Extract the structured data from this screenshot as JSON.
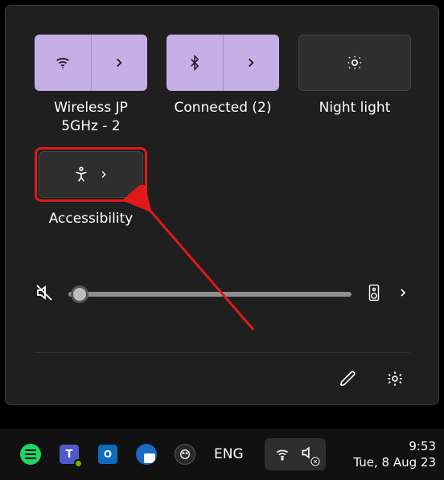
{
  "tiles": {
    "wifi": {
      "label": "Wireless JP 5GHz - 2",
      "on": true
    },
    "bluetooth": {
      "label": "Connected (2)",
      "on": true
    },
    "nightlight": {
      "label": "Night light",
      "on": false
    },
    "accessibility": {
      "label": "Accessibility",
      "on": false
    }
  },
  "volume": {
    "muted": true,
    "percent": 4
  },
  "taskbar": {
    "lang": "ENG",
    "time": "9:53",
    "date": "Tue, 8 Aug 23"
  }
}
